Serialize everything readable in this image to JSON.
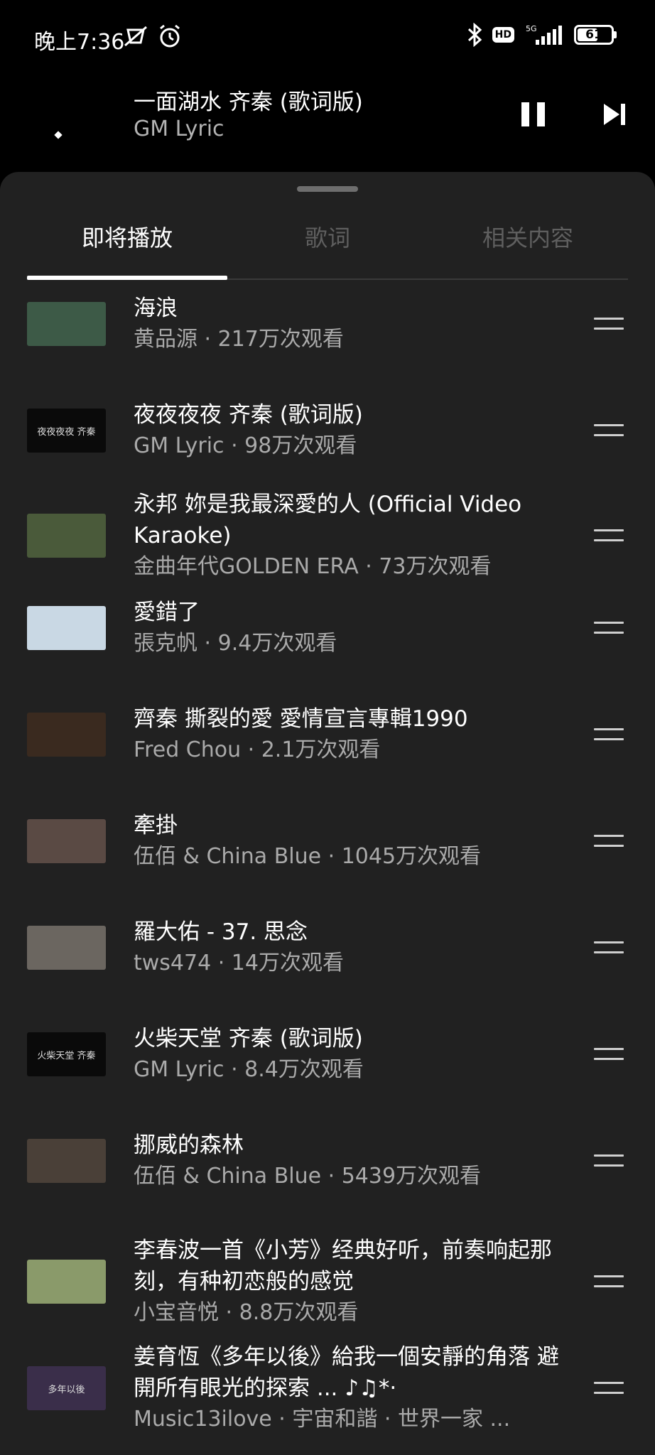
{
  "status_bar": {
    "time": "晚上7:36",
    "hd": "HD",
    "network": "5G",
    "battery": "61",
    "battery_level": 0.61
  },
  "now_playing": {
    "title": "一面湖水 齐秦 (歌词版)",
    "artist": "GM Lyric",
    "pause_icon": "pause-icon",
    "next_icon": "skip-next-icon"
  },
  "tabs": [
    {
      "label": "即将播放",
      "active": true
    },
    {
      "label": "歌词",
      "active": false
    },
    {
      "label": "相关内容",
      "active": false
    }
  ],
  "queue": [
    {
      "title": "海浪",
      "subtitle": "黄品源 · 217万次观看",
      "thumb_color": "#3d5a47"
    },
    {
      "title": "夜夜夜夜 齐秦 (歌词版)",
      "subtitle": "GM Lyric · 98万次观看",
      "thumb_color": "#0a0a0a",
      "thumb_text": "夜夜夜夜 齐秦"
    },
    {
      "title": "永邦 妳是我最深愛的人 (Official Video Karaoke)",
      "subtitle": "金曲年代GOLDEN ERA · 73万次观看",
      "thumb_color": "#4a5a3a"
    },
    {
      "title": "愛錯了",
      "subtitle": "張克帆 · 9.4万次观看",
      "thumb_color": "#c9d8e4"
    },
    {
      "title": "齊秦 撕裂的愛 愛情宣言專輯1990",
      "subtitle": "Fred Chou · 2.1万次观看",
      "thumb_color": "#3a2a1f"
    },
    {
      "title": "牽掛",
      "subtitle": "伍佰 & China Blue · 1045万次观看",
      "thumb_color": "#5a4a44"
    },
    {
      "title": "羅大佑 - 37. 思念",
      "subtitle": "tws474 · 14万次观看",
      "thumb_color": "#6b6660"
    },
    {
      "title": "火柴天堂 齐秦 (歌词版)",
      "subtitle": "GM Lyric · 8.4万次观看",
      "thumb_color": "#0a0a0a",
      "thumb_text": "火柴天堂 齐秦"
    },
    {
      "title": "挪威的森林",
      "subtitle": "伍佰 & China Blue · 5439万次观看",
      "thumb_color": "#4a4038"
    },
    {
      "title": "李春波一首《小芳》经典好听，前奏响起那刻，有种初恋般的感觉",
      "subtitle": "小宝音悦 · 8.8万次观看",
      "thumb_color": "#8a9a6a"
    },
    {
      "title": "姜育恆《多年以後》給我一個安靜的角落 避開所有眼光的探索 ... ♪♫*·",
      "subtitle": "Music13ilove · 宇宙和諧 · 世界一家 ...",
      "thumb_color": "#3a2e4a",
      "thumb_text": "多年以後"
    }
  ],
  "icons": {
    "drag": "drag-handle-icon",
    "bluetooth": "bluetooth-icon",
    "alarm": "alarm-icon",
    "mute": "vibrate-mute-icon",
    "signal": "signal-icon"
  }
}
